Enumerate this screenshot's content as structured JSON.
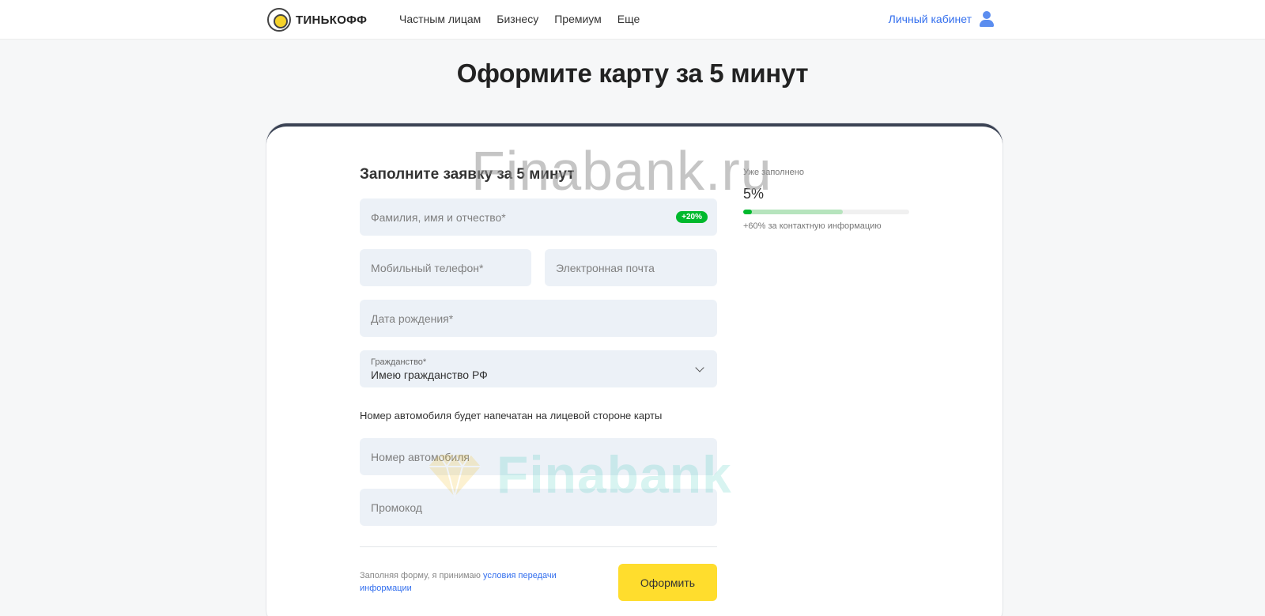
{
  "header": {
    "logo_text": "ТИНЬКОФФ",
    "nav": [
      "Частным лицам",
      "Бизнесу",
      "Премиум",
      "Еще"
    ],
    "cabinet_label": "Личный кабинет"
  },
  "page_title": "Оформите карту за 5 минут",
  "form": {
    "heading": "Заполните заявку за 5 минут",
    "fio_placeholder": "Фамилия, имя и отчество*",
    "fio_badge": "+20%",
    "phone_placeholder": "Мобильный телефон*",
    "email_placeholder": "Электронная почта",
    "birth_placeholder": "Дата рождения*",
    "citizenship_label": "Гражданство*",
    "citizenship_value": "Имею гражданство РФ",
    "car_info": "Номер автомобиля будет напечатан на лицевой стороне карты",
    "car_placeholder": "Номер автомобиля",
    "promo_placeholder": "Промокод",
    "consent_text": "Заполняя форму, я принимаю ",
    "consent_link": "условия передачи информации",
    "submit_label": "Оформить"
  },
  "progress": {
    "label": "Уже заполнено",
    "value_text": "5%",
    "fill_fraction": 0.05,
    "potential_fraction": 0.6,
    "hint": "+60% за контактную информацию"
  },
  "watermark": {
    "text": "Finabank.ru",
    "logo_word": "Finabank"
  },
  "colors": {
    "accent_yellow": "#ffdd2d",
    "link_blue": "#336fee",
    "success_green": "#00b92d"
  }
}
